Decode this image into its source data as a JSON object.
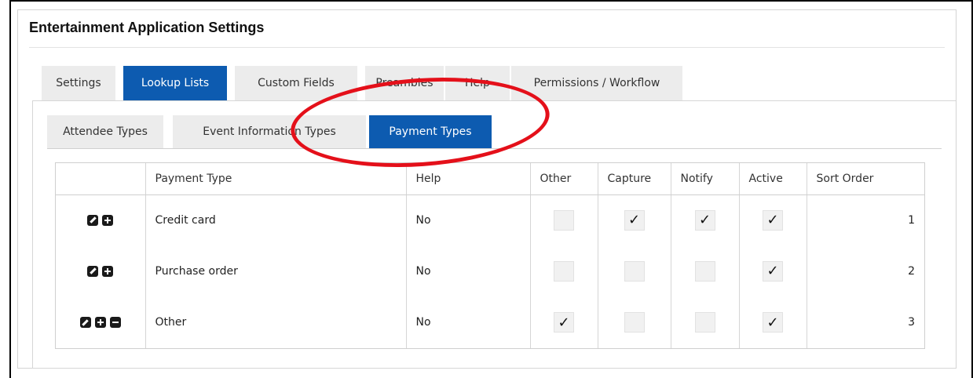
{
  "title": "Entertainment Application Settings",
  "tabs": [
    {
      "label": "Settings",
      "active": false
    },
    {
      "label": "Lookup Lists",
      "active": true
    },
    {
      "label": "Custom Fields",
      "active": false
    },
    {
      "label": "Preambles",
      "active": false
    },
    {
      "label": "Help",
      "active": false
    },
    {
      "label": "Permissions / Workflow",
      "active": false
    }
  ],
  "subtabs": [
    {
      "label": "Attendee Types",
      "active": false
    },
    {
      "label": "Event Information Types",
      "active": false
    },
    {
      "label": "Payment Types",
      "active": true
    }
  ],
  "table": {
    "headers": [
      "",
      "Payment Type",
      "Help",
      "Other",
      "Capture",
      "Notify",
      "Active",
      "Sort Order"
    ],
    "rows": [
      {
        "name": "Credit card",
        "help": "No",
        "other": false,
        "capture": true,
        "notify": true,
        "active": true,
        "sort": "1",
        "actions": [
          "edit",
          "add"
        ]
      },
      {
        "name": "Purchase order",
        "help": "No",
        "other": false,
        "capture": false,
        "notify": false,
        "active": true,
        "sort": "2",
        "actions": [
          "edit",
          "add"
        ]
      },
      {
        "name": "Other",
        "help": "No",
        "other": true,
        "capture": false,
        "notify": false,
        "active": true,
        "sort": "3",
        "actions": [
          "edit",
          "add",
          "remove"
        ]
      }
    ]
  },
  "checkmark": "✓",
  "colors": {
    "accent": "#0d5bb0",
    "highlight": "#e4101a"
  }
}
